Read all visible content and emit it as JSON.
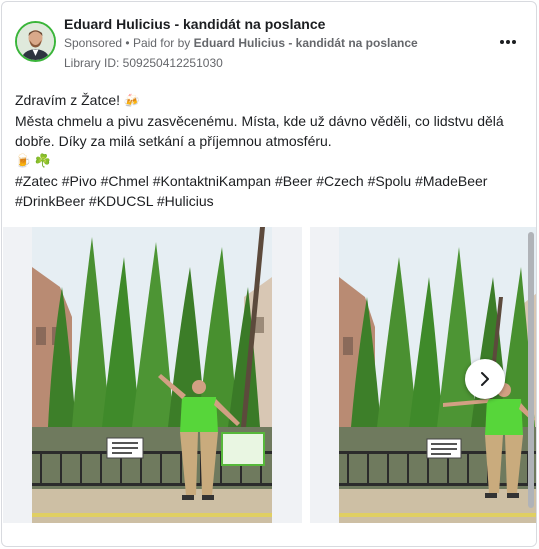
{
  "ad": {
    "page_name": "Eduard Hulicius - kandidát na poslance",
    "sponsored_label": "Sponsored",
    "separator": "•",
    "paid_for_prefix": "Paid for by",
    "paid_for_by": "Eduard Hulicius - kandidát na poslance",
    "library_id": "Library ID: 509250412251030",
    "more_icon": "more-horizontal-icon"
  },
  "post": {
    "greeting": "Zdravím z Žatce!",
    "greeting_emoji": "🍻",
    "line_1": "Města chmelu a pivu zasvěcenému. Místa, kde už dávno věděli, co lidstvu dělá dobře. Díky za milá setkání a příjemnou atmosféru.",
    "emoji_line": "🍺 ☘️",
    "hashtags": [
      "#Zatec",
      "#Pivo",
      "#Chmel",
      "#KontaktniKampan",
      "#Beer",
      "#Czech",
      "#Spolu",
      "#MadeBeer",
      "#DrinkBeer",
      "#KDUCSL",
      "#Hulicius"
    ]
  },
  "carousel": {
    "slide_1_sign": "ECHTER ZENTRUM CHMELE NA GRETU",
    "slide_2_sign": "ECHTER ZENTRUM CHMELE NA GRETU",
    "next_icon": "chevron-right-icon"
  },
  "colors": {
    "avatar_ring": "#3ab53a",
    "shirt": "#57d63a",
    "hop_green": "#3f8a2a",
    "sky": "#e6eef3"
  }
}
